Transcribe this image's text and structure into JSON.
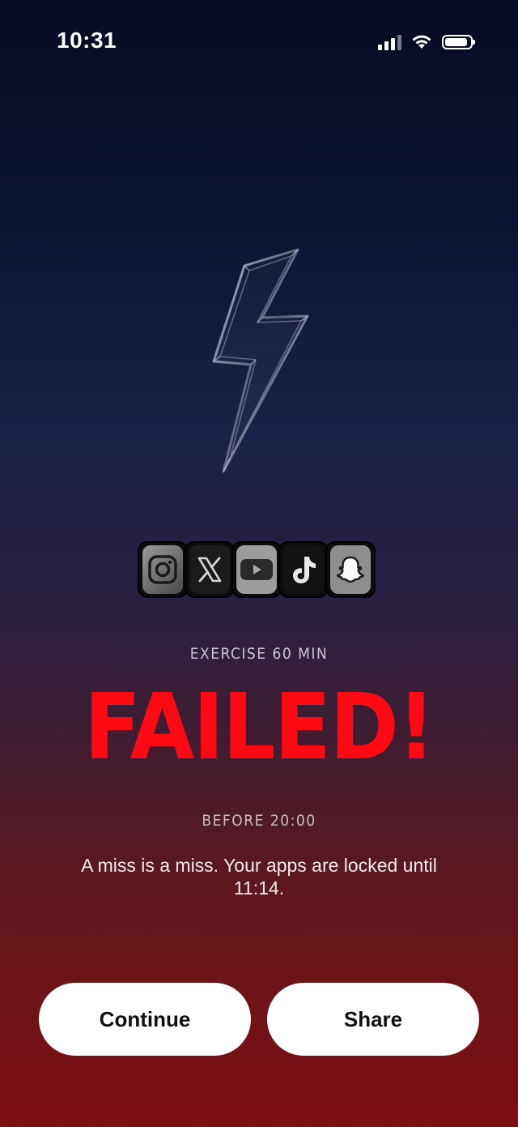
{
  "status_bar": {
    "time": "10:31",
    "signal_icon": "cellular-signal-icon",
    "wifi_icon": "wifi-icon",
    "battery_icon": "battery-icon",
    "battery_level": 0.9
  },
  "hero": {
    "icon": "lightning-bolt-icon"
  },
  "blocked_apps": [
    {
      "name": "instagram-icon"
    },
    {
      "name": "x-icon"
    },
    {
      "name": "youtube-icon"
    },
    {
      "name": "tiktok-icon"
    },
    {
      "name": "snapchat-icon"
    }
  ],
  "result": {
    "goal_label": "EXERCISE 60 MIN",
    "status_text": "FAILED!",
    "deadline_label": "BEFORE 20:00",
    "message": "A miss is a miss. Your apps are locked until 11:14."
  },
  "actions": {
    "continue_label": "Continue",
    "share_label": "Share"
  },
  "colors": {
    "failed": "#ff0a14",
    "background_top": "#070b24",
    "background_bottom": "#7e0f12",
    "button_bg": "#ffffff"
  }
}
